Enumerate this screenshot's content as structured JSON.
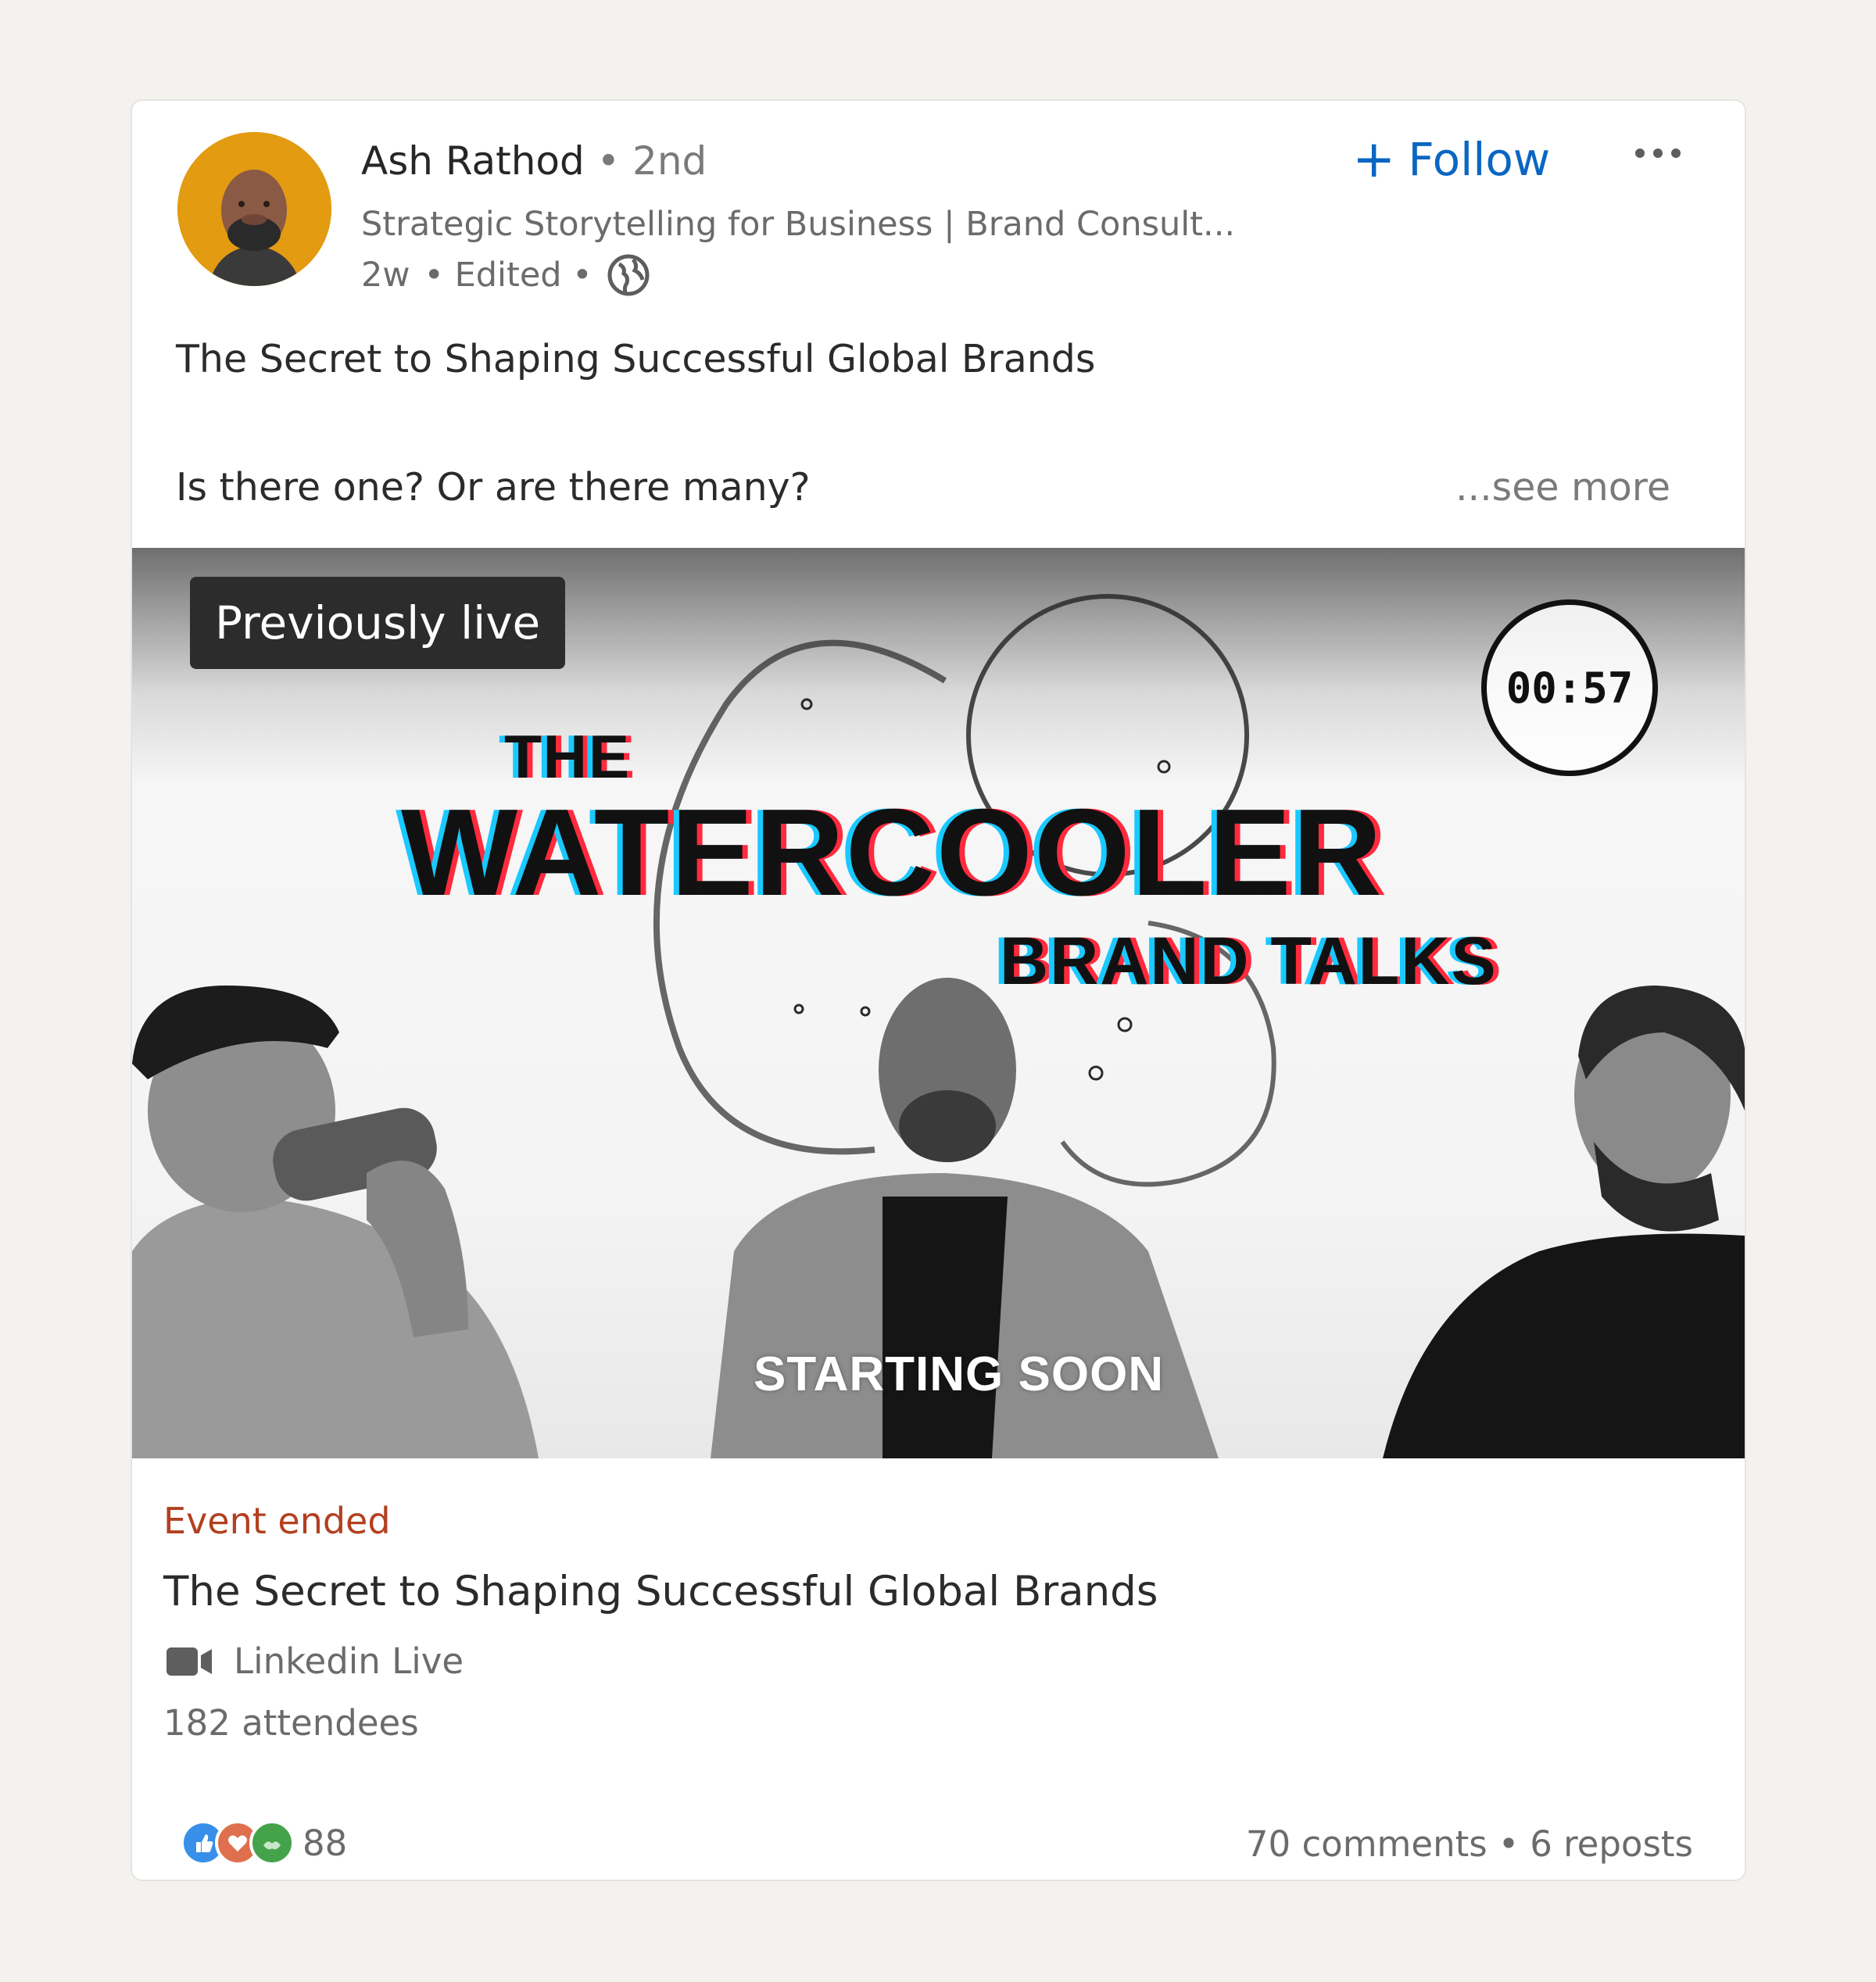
{
  "author": {
    "name": "Ash Rathod",
    "degree": "• 2nd",
    "headline": "Strategic Storytelling for Business | Brand Consult...",
    "time": "2w",
    "edited": "• Edited •",
    "visibility_icon": "globe-icon"
  },
  "actions": {
    "follow_icon": "+",
    "follow_label": "Follow",
    "more_icon": "ellipsis-icon"
  },
  "post": {
    "title": "The Secret to Shaping Successful Global Brands",
    "line2": "Is there one? Or are there many?",
    "see_more": "...see more"
  },
  "media": {
    "badge": "Previously live",
    "timer": "00:57",
    "show_title_the": "THE",
    "show_title_main": "WATERCOOLER",
    "show_title_sub": "BRAND TALKS",
    "caption": "STARTING SOON"
  },
  "event": {
    "status": "Event ended",
    "title": "The Secret to Shaping Successful Global Brands",
    "type_icon": "video-camera-icon",
    "type": "Linkedin Live",
    "attendees": "182 attendees"
  },
  "social": {
    "reaction_icons": [
      "like-icon",
      "love-icon",
      "support-icon"
    ],
    "reaction_count": "88",
    "comments": "70 comments",
    "separator": "•",
    "reposts": "6 reposts"
  },
  "colors": {
    "background": "#f3f2ef",
    "follow_blue": "#0a66c2",
    "event_status": "#b24020",
    "avatar_bg": "#e39b12"
  }
}
